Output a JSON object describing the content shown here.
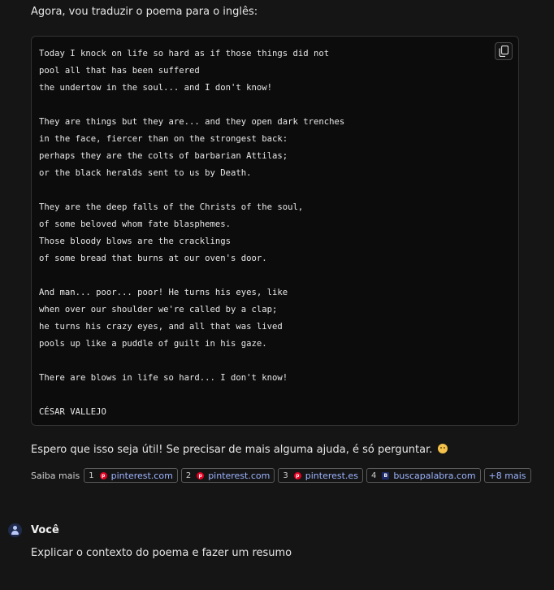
{
  "assistant": {
    "intro": "Agora, vou traduzir o poema para o inglês:",
    "code_lines": [
      "Today I knock on life so hard as if those things did not",
      "pool all that has been suffered",
      "the undertow in the soul... and I don't know!",
      "",
      "They are things but they are... and they open dark trenches",
      "in the face, fiercer than on the strongest back:",
      "perhaps they are the colts of barbarian Attilas;",
      "or the black heralds sent to us by Death.",
      "",
      "They are the deep falls of the Christs of the soul,",
      "of some beloved whom fate blasphemes.",
      "Those bloody blows are the cracklings",
      "of some bread that burns at our oven's door.",
      "",
      "And man... poor... poor! He turns his eyes, like",
      "when over our shoulder we're called by a clap;",
      "he turns his crazy eyes, and all that was lived",
      "pools up like a puddle of guilt in his gaze.",
      "",
      "There are blows in life so hard... I don't know!",
      "",
      "CÉSAR VALLEJO"
    ],
    "copy_icon": "copy-icon",
    "closing": "Espero que isso seja útil! Se precisar de mais alguma ajuda, é só perguntar.",
    "closing_emoji": "smiling-face-emoji"
  },
  "sources": {
    "label": "Saiba mais",
    "items": [
      {
        "num": "1",
        "domain": "pinterest.com",
        "icon": "pinterest-icon",
        "color": "#e60023"
      },
      {
        "num": "2",
        "domain": "pinterest.com",
        "icon": "pinterest-icon",
        "color": "#e60023"
      },
      {
        "num": "3",
        "domain": "pinterest.es",
        "icon": "pinterest-icon",
        "color": "#e60023"
      },
      {
        "num": "4",
        "domain": "buscapalabra.com",
        "icon": "buscapalabra-icon",
        "color": "#1d2a6b"
      }
    ],
    "more": "+8 mais"
  },
  "user": {
    "name": "Você",
    "message": "Explicar o contexto do poema e fazer um resumo",
    "avatar_icon": "user-avatar-icon"
  },
  "colors": {
    "background": "#151515",
    "code_background": "#0c0c0c",
    "link": "#9db4ff"
  }
}
